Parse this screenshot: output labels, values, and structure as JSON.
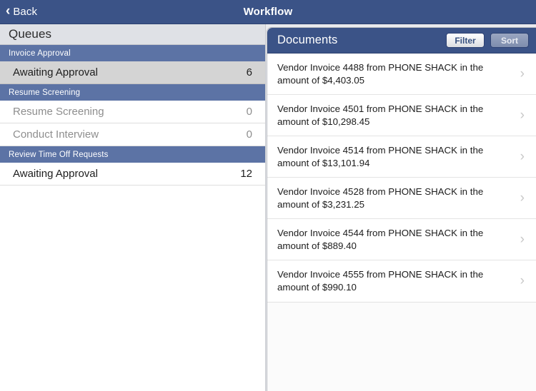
{
  "navbar": {
    "back_label": "Back",
    "back_icon": "chevron-left-icon",
    "title": "Workflow"
  },
  "colors": {
    "navbar_blue": "#3b5387",
    "section_header_blue": "#5c73a5",
    "selected_row_gray": "#d4d4d4",
    "queues_header_gray": "#dfe1e6",
    "disabled_text": "#8e8e8e"
  },
  "sidebar": {
    "header": "Queues",
    "sections": [
      {
        "title": "Invoice Approval",
        "rows": [
          {
            "label": "Awaiting Approval",
            "count": "6",
            "selected": true,
            "disabled": false
          }
        ]
      },
      {
        "title": "Resume Screening",
        "rows": [
          {
            "label": "Resume Screening",
            "count": "0",
            "selected": false,
            "disabled": true
          },
          {
            "label": "Conduct Interview",
            "count": "0",
            "selected": false,
            "disabled": true
          }
        ]
      },
      {
        "title": "Review Time Off Requests",
        "rows": [
          {
            "label": "Awaiting Approval",
            "count": "12",
            "selected": false,
            "disabled": false
          }
        ]
      }
    ]
  },
  "detail": {
    "title": "Documents",
    "filter_label": "Filter",
    "sort_label": "Sort",
    "disclosure_icon": "chevron-right-icon",
    "documents": [
      {
        "text": "Vendor Invoice 4488 from PHONE SHACK in the amount of $4,403.05"
      },
      {
        "text": "Vendor Invoice 4501 from PHONE SHACK in the amount of $10,298.45"
      },
      {
        "text": "Vendor Invoice 4514 from PHONE SHACK in the amount of $13,101.94"
      },
      {
        "text": "Vendor Invoice 4528 from PHONE SHACK in the amount of $3,231.25"
      },
      {
        "text": "Vendor Invoice 4544 from PHONE SHACK in the amount of $889.40"
      },
      {
        "text": "Vendor Invoice 4555 from PHONE SHACK in the amount of $990.10"
      }
    ]
  }
}
